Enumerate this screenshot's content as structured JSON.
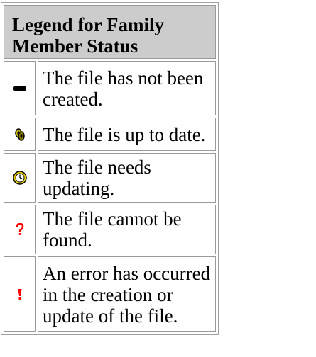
{
  "legend": {
    "title": "Legend for Family Member Status",
    "rows": [
      {
        "icon": "not-created-dash-icon",
        "text": "The file has not been created."
      },
      {
        "icon": "up-to-date-chain-icon",
        "text": "The file is up to date."
      },
      {
        "icon": "needs-updating-clock-icon",
        "text": "The file needs updating."
      },
      {
        "icon": "not-found-question-icon",
        "text": "The file cannot be found."
      },
      {
        "icon": "error-exclamation-icon",
        "text": "An error has occurred in the creation or update of the file."
      }
    ]
  },
  "colors": {
    "header_bg": "#cccccc",
    "border": "#9a9a9a",
    "error_red": "#ff0000",
    "clock_yellow": "#e8d400"
  }
}
